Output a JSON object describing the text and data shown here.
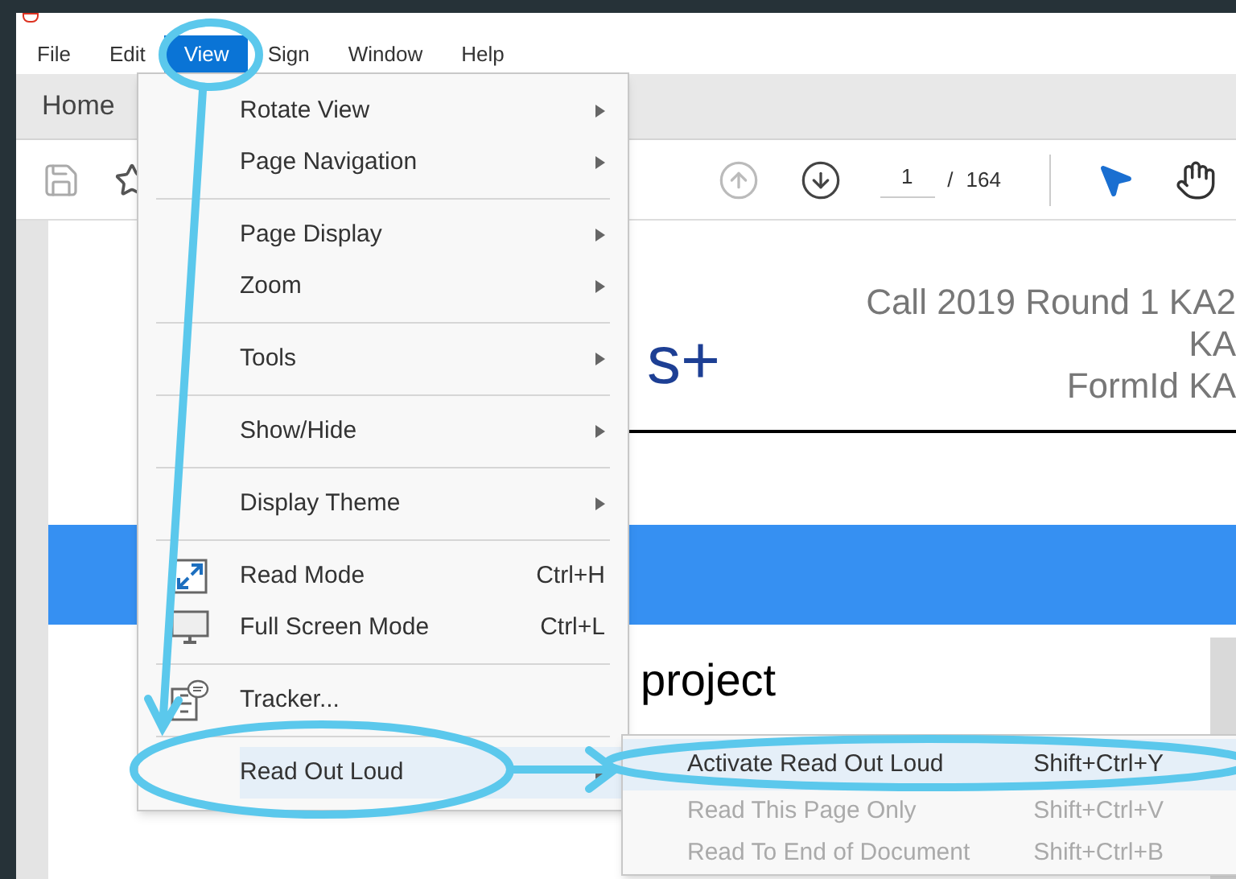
{
  "menu_bar": [
    {
      "label": "File",
      "selected": false
    },
    {
      "label": "Edit",
      "selected": false
    },
    {
      "label": "View",
      "selected": true
    },
    {
      "label": "Sign",
      "selected": false
    },
    {
      "label": "Window",
      "selected": false
    },
    {
      "label": "Help",
      "selected": false
    }
  ],
  "tabs": [
    {
      "label": "Home"
    }
  ],
  "toolbar": {
    "page_current": "1",
    "page_separator": "/",
    "page_count": "164"
  },
  "document": {
    "logo_text": "s+",
    "header_lines": [
      "Call 2019 Round 1 KA2",
      "KA",
      "FormId KA"
    ],
    "heading": "project"
  },
  "view_menu": {
    "groups": [
      [
        {
          "label": "Rotate View",
          "kind": "submenu",
          "selected": false
        },
        {
          "label": "Page Navigation",
          "kind": "submenu",
          "selected": false
        }
      ],
      [
        {
          "label": "Page Display",
          "kind": "submenu",
          "selected": false
        },
        {
          "label": "Zoom",
          "kind": "submenu",
          "selected": false
        }
      ],
      [
        {
          "label": "Tools",
          "kind": "submenu",
          "selected": false
        }
      ],
      [
        {
          "label": "Show/Hide",
          "kind": "submenu",
          "selected": false
        }
      ],
      [
        {
          "label": "Display Theme",
          "kind": "submenu",
          "selected": false
        }
      ],
      [
        {
          "label": "Read Mode",
          "kind": "expand",
          "shortcut": "Ctrl+H",
          "selected": false
        },
        {
          "label": "Full Screen Mode",
          "kind": "monitor",
          "shortcut": "Ctrl+L",
          "selected": false
        }
      ],
      [
        {
          "label": "Tracker...",
          "kind": "tracker",
          "selected": false
        }
      ],
      [
        {
          "label": "Read Out Loud",
          "kind": "submenu",
          "selected": true
        }
      ]
    ]
  },
  "read_out_loud_menu": [
    {
      "label": "Activate Read Out Loud",
      "shortcut": "Shift+Ctrl+Y",
      "disabled": false,
      "selected": true
    },
    {
      "label": "Read This Page Only",
      "shortcut": "Shift+Ctrl+V",
      "disabled": true,
      "selected": false
    },
    {
      "label": "Read To End of Document",
      "shortcut": "Shift+Ctrl+B",
      "disabled": true,
      "selected": false
    }
  ]
}
